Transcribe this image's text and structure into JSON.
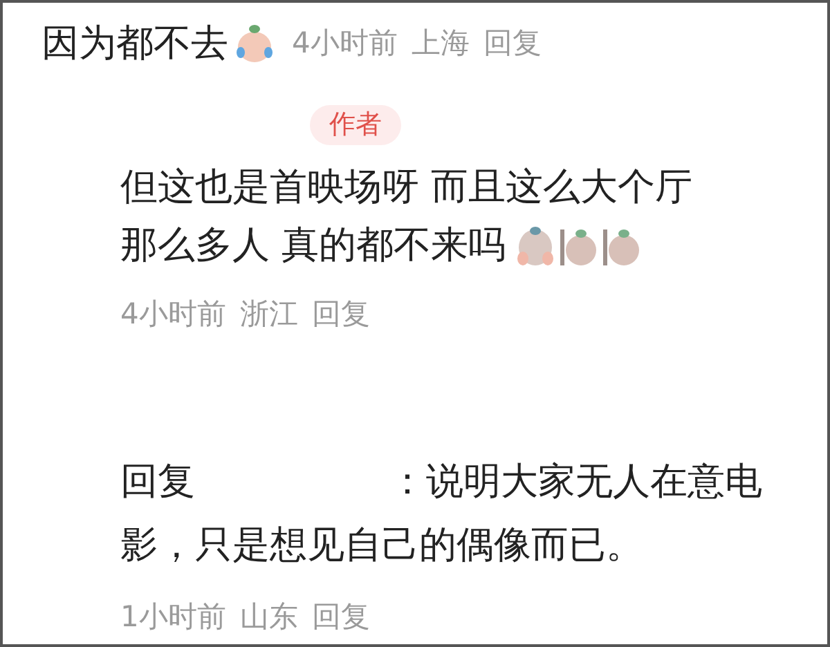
{
  "top_comment": {
    "text": "因为都不去",
    "stickers": [
      {
        "kind": "crying"
      }
    ],
    "time": "4小时前",
    "location": "上海",
    "reply": "回复"
  },
  "author_reply": {
    "badge": "作者",
    "lines": [
      "但这也是首映场呀 而且这么大个厅",
      "那么多人 真的都不来吗"
    ],
    "stickers": [
      {
        "kind": "shocked"
      },
      {
        "kind": "peeking"
      },
      {
        "kind": "peeking"
      }
    ],
    "time": "4小时前",
    "location": "浙江",
    "reply": "回复"
  },
  "reply": {
    "prefix": "回复",
    "body": "：说明大家无人在意电影，只是想见自己的偶像而已。",
    "time": "1小时前",
    "location": "山东",
    "reply": "回复"
  }
}
